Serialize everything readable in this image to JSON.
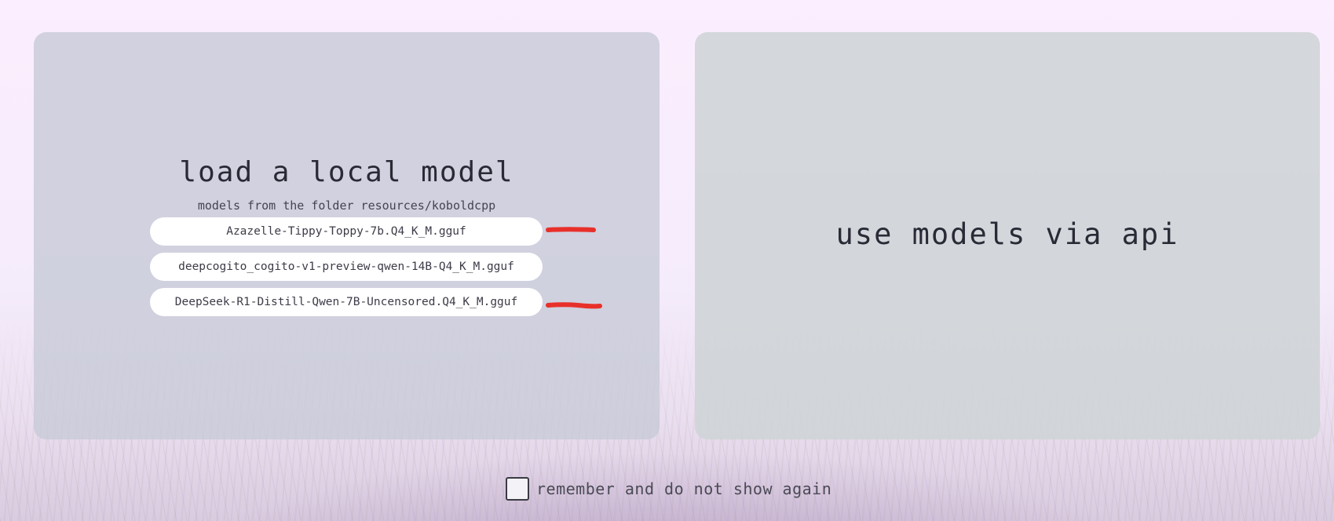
{
  "local_panel": {
    "title": "load a local model",
    "subtitle": "models from the folder resources/koboldcpp",
    "models": [
      "Azazelle-Tippy-Toppy-7b.Q4_K_M.gguf",
      "deepcogito_cogito-v1-preview-qwen-14B-Q4_K_M.gguf",
      "DeepSeek-R1-Distill-Qwen-7B-Uncensored.Q4_K_M.gguf"
    ]
  },
  "api_panel": {
    "title": "use models via api"
  },
  "footer": {
    "remember_label": "remember and do not show again",
    "remember_checked": false
  },
  "colors": {
    "annotation_mark": "#e8302a",
    "panel_local_bg": "#c8cad8",
    "panel_api_bg": "#ced4d6"
  }
}
